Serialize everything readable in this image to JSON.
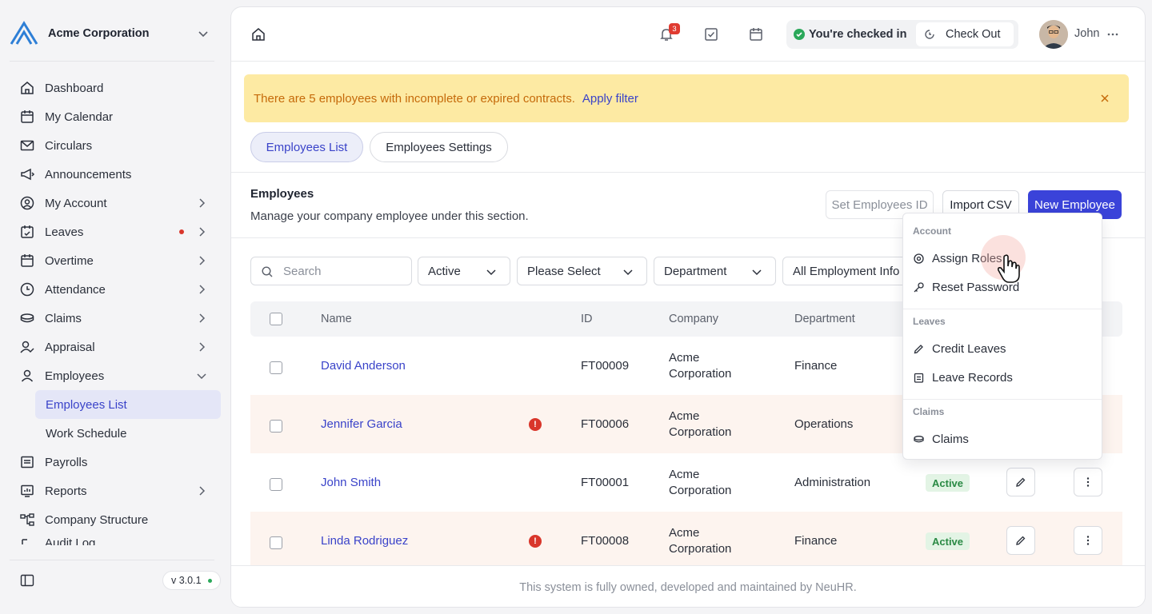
{
  "sidebar": {
    "company": "Acme Corporation",
    "items": [
      {
        "label": "Dashboard",
        "icon": "home-icon",
        "arrow": false
      },
      {
        "label": "My Calendar",
        "icon": "calendar-icon",
        "arrow": false
      },
      {
        "label": "Circulars",
        "icon": "mail-icon",
        "arrow": false
      },
      {
        "label": "Announcements",
        "icon": "megaphone-icon",
        "arrow": false
      },
      {
        "label": "My Account",
        "icon": "user-circle-icon",
        "arrow": true
      },
      {
        "label": "Leaves",
        "icon": "calendar-check-icon",
        "arrow": true,
        "dot": true
      },
      {
        "label": "Overtime",
        "icon": "calendar-plus-icon",
        "arrow": true
      },
      {
        "label": "Attendance",
        "icon": "clock-icon",
        "arrow": true
      },
      {
        "label": "Claims",
        "icon": "coins-icon",
        "arrow": true
      },
      {
        "label": "Appraisal",
        "icon": "user-check-icon",
        "arrow": true
      },
      {
        "label": "Employees",
        "icon": "user-icon",
        "arrow": "down"
      }
    ],
    "sub_items": [
      {
        "label": "Employees List",
        "active": true
      },
      {
        "label": "Work Schedule",
        "active": false
      }
    ],
    "items_after": [
      {
        "label": "Payrolls",
        "icon": "receipt-icon"
      },
      {
        "label": "Reports",
        "icon": "report-icon",
        "arrow": true
      },
      {
        "label": "Company Structure",
        "icon": "org-chart-icon"
      },
      {
        "label": "Audit Log",
        "icon": "audit-icon"
      }
    ],
    "version": "v 3.0.1"
  },
  "topbar": {
    "notification_count": "3",
    "checkin_text": "You're checked in",
    "checkout_label": "Check Out",
    "user_name": "John"
  },
  "alert": {
    "text": "There are 5 employees with incomplete or expired contracts.",
    "link": "Apply filter"
  },
  "tabs": [
    "Employees List",
    "Employees Settings"
  ],
  "section": {
    "title": "Employees",
    "description": "Manage your company employee under this section.",
    "btn_set_id": "Set Employees ID",
    "btn_import": "Import CSV",
    "btn_new": "New Employee"
  },
  "filters": {
    "search_placeholder": "Search",
    "status": "Active",
    "select": "Please Select",
    "department": "Department",
    "employment": "All Employment Info"
  },
  "table": {
    "headers": [
      "Name",
      "ID",
      "Company",
      "Department"
    ],
    "rows": [
      {
        "name": "David Anderson",
        "id": "FT00009",
        "company_1": "Acme",
        "company_2": "Corporation",
        "department": "Finance",
        "status": "",
        "warn": false
      },
      {
        "name": "Jennifer Garcia",
        "id": "FT00006",
        "company_1": "Acme",
        "company_2": "Corporation",
        "department": "Operations",
        "status": "",
        "warn": true
      },
      {
        "name": "John Smith",
        "id": "FT00001",
        "company_1": "Acme",
        "company_2": "Corporation",
        "department": "Administration",
        "status": "Active",
        "warn": false
      },
      {
        "name": "Linda Rodriguez",
        "id": "FT00008",
        "company_1": "Acme",
        "company_2": "Corporation",
        "department": "Finance",
        "status": "Active",
        "warn": true
      }
    ]
  },
  "menu": {
    "group_account": "Account",
    "assign_roles": "Assign Roles",
    "reset_password": "Reset Password",
    "group_leaves": "Leaves",
    "credit_leaves": "Credit Leaves",
    "leave_records": "Leave Records",
    "group_claims": "Claims",
    "claims": "Claims"
  },
  "footer": "This system is fully owned, developed and maintained by NeuHR.",
  "colors": {
    "accent": "#3a43d9",
    "alert_bg": "#fdeaa3",
    "alert_text": "#c56a0a",
    "success": "#2aa85a",
    "danger": "#d9362b"
  }
}
